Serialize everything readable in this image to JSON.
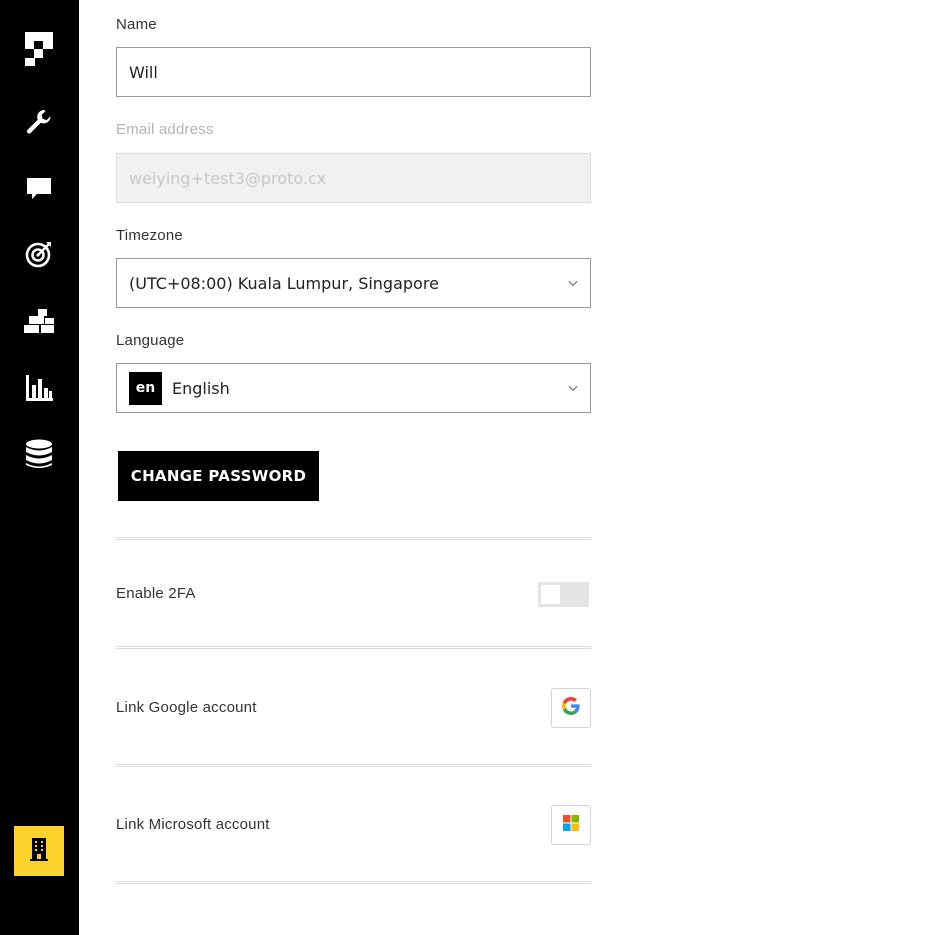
{
  "sidebar": {
    "items": [
      {
        "icon": "logo-icon"
      },
      {
        "icon": "wrench-icon"
      },
      {
        "icon": "chat-icon"
      },
      {
        "icon": "target-icon"
      },
      {
        "icon": "blocks-icon"
      },
      {
        "icon": "bar-chart-icon"
      },
      {
        "icon": "database-icon"
      }
    ],
    "org_button": {
      "icon": "building-icon",
      "color": "#fdd32b"
    }
  },
  "profile": {
    "name_label": "Name",
    "name_value": "Will",
    "email_label": "Email address",
    "email_value": "weiying+test3@proto.cx",
    "timezone_label": "Timezone",
    "timezone_value": "(UTC+08:00) Kuala Lumpur, Singapore",
    "language_label": "Language",
    "language_code": "en",
    "language_value": "English",
    "change_password_label": "CHANGE PASSWORD"
  },
  "security": {
    "twofa_label": "Enable 2FA",
    "twofa_enabled": false,
    "google_label": "Link Google account",
    "microsoft_label": "Link Microsoft account"
  }
}
